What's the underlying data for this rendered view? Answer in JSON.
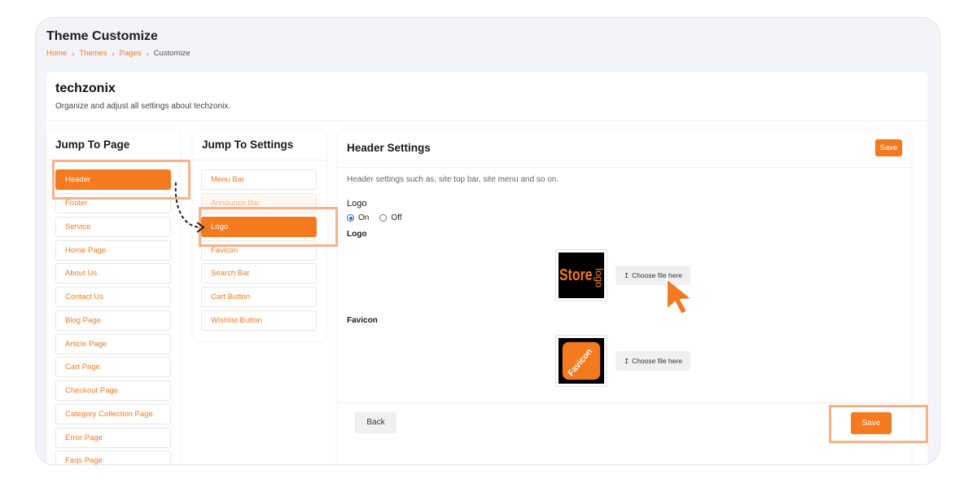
{
  "page": {
    "title": "Theme Customize",
    "breadcrumb": [
      "Home",
      "Themes",
      "Pages",
      "Customize"
    ]
  },
  "theme": {
    "name": "techzonix",
    "description": "Organize and adjust all settings about techzonix."
  },
  "jump_to_page": {
    "title": "Jump To Page",
    "items": [
      "Header",
      "Footer",
      "Service",
      "Home Page",
      "About Us",
      "Contact Us",
      "Blog Page",
      "Article Page",
      "Cart Page",
      "Checkout Page",
      "Category Collection Page",
      "Error Page",
      "Faqs Page"
    ],
    "active_index": 0
  },
  "jump_to_settings": {
    "title": "Jump To Settings",
    "items": [
      "Menu Bar",
      "Announce Bar",
      "Logo",
      "Favicon",
      "Search Bar",
      "Cart Button",
      "Wishlist Button"
    ],
    "active_index": 2
  },
  "header_settings": {
    "title": "Header Settings",
    "save_label": "Save",
    "description": "Header settings such as, site top bar, site menu and so on.",
    "logo_toggle_label": "Logo",
    "option_on": "On",
    "option_off": "Off",
    "logo_toggle_value": "On",
    "logo_label": "Logo",
    "logo_image_text": [
      "Store",
      "logo"
    ],
    "favicon_label": "Favicon",
    "favicon_image_text": "Favicon",
    "choose_file_label": "Choose file here",
    "back_label": "Back",
    "footer_save_label": "Save"
  },
  "colors": {
    "accent": "#f47a20",
    "highlight": "#f6b38a"
  }
}
